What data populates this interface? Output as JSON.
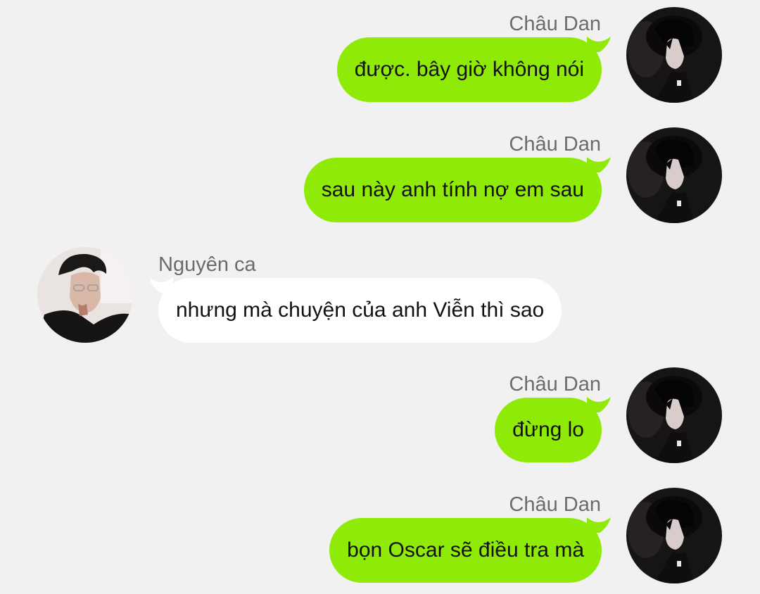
{
  "conversation": {
    "messages": [
      {
        "sender": "Châu Dan",
        "text": "được. bây giờ không nói",
        "direction": "out"
      },
      {
        "sender": "Châu Dan",
        "text": "sau này anh tính nợ em sau",
        "direction": "out"
      },
      {
        "sender": "Nguyên ca",
        "text": "nhưng mà chuyện của anh Viễn thì sao",
        "direction": "in"
      },
      {
        "sender": "Châu Dan",
        "text": "đừng lo",
        "direction": "out"
      },
      {
        "sender": "Châu Dan",
        "text": "bọn Oscar sẽ điều tra mà",
        "direction": "out"
      }
    ]
  },
  "colors": {
    "background": "#f1f1f1",
    "outgoing_bubble": "#8fea07",
    "incoming_bubble": "#ffffff",
    "sender_name": "#6b6b6b",
    "message_text": "#111111"
  },
  "icons": {
    "outgoing_avatar": "user-avatar-chau-dan",
    "incoming_avatar": "user-avatar-nguyen-ca"
  }
}
